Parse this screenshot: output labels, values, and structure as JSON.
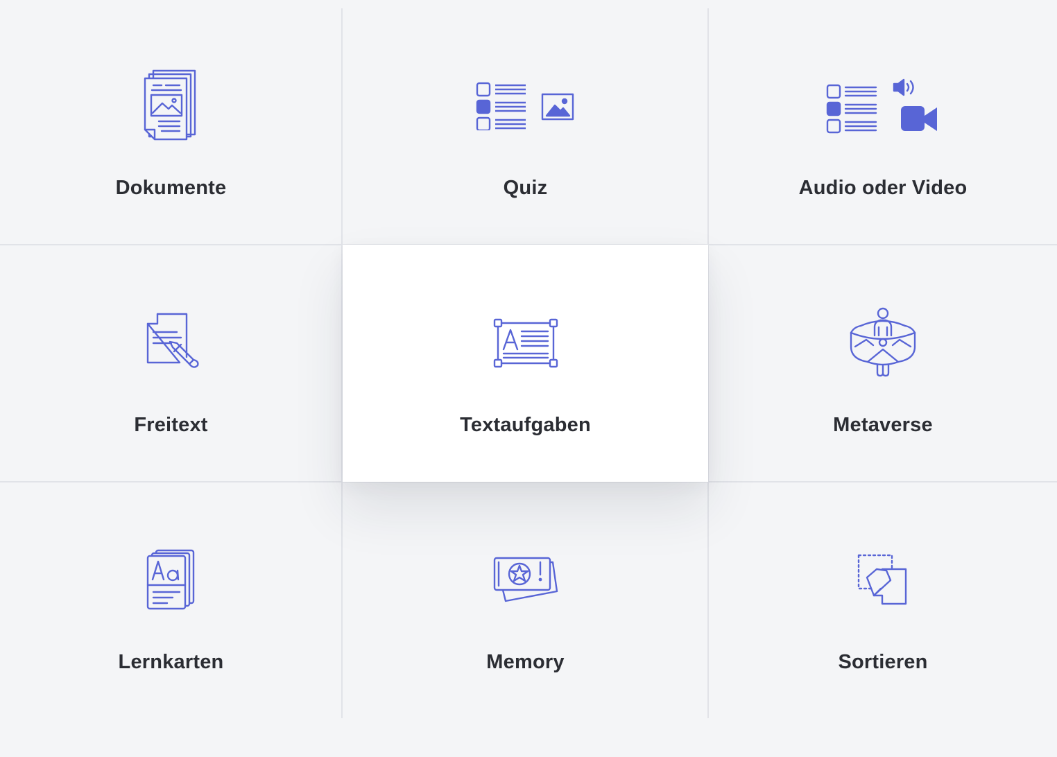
{
  "tiles": [
    {
      "label": "Dokumente",
      "icon": "documents-icon"
    },
    {
      "label": "Quiz",
      "icon": "quiz-icon"
    },
    {
      "label": "Audio oder Video",
      "icon": "audio-video-icon"
    },
    {
      "label": "Freitext",
      "icon": "free-text-icon"
    },
    {
      "label": "Textaufgaben",
      "icon": "text-task-icon",
      "selected": true
    },
    {
      "label": "Metaverse",
      "icon": "metaverse-icon"
    },
    {
      "label": "Lernkarten",
      "icon": "flashcards-icon"
    },
    {
      "label": "Memory",
      "icon": "memory-cards-icon"
    },
    {
      "label": "Sortieren",
      "icon": "sort-icon"
    }
  ],
  "colors": {
    "accent": "#5865d6",
    "background": "#f4f5f7",
    "selected_background": "#ffffff",
    "divider": "#e1e3e8",
    "text": "#2b2d33"
  }
}
